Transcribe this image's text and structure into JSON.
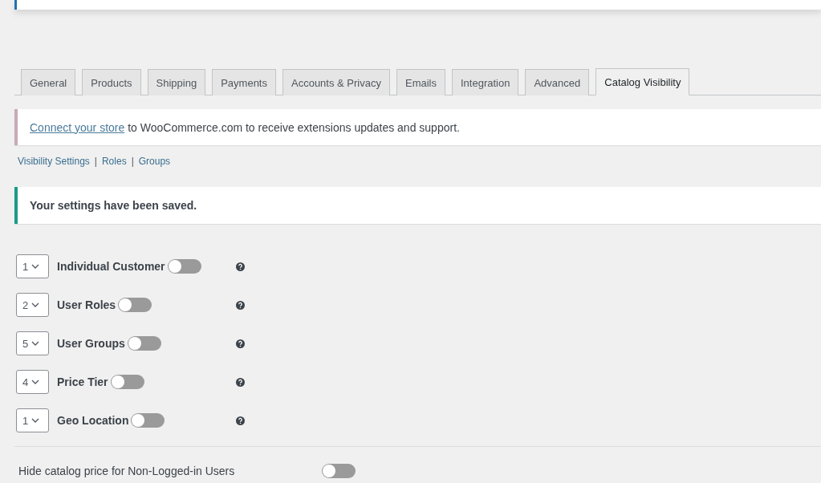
{
  "tabs": [
    {
      "label": "General",
      "selected": false
    },
    {
      "label": "Products",
      "selected": false
    },
    {
      "label": "Shipping",
      "selected": false
    },
    {
      "label": "Payments",
      "selected": false
    },
    {
      "label": "Accounts & Privacy",
      "selected": false
    },
    {
      "label": "Emails",
      "selected": false
    },
    {
      "label": "Integration",
      "selected": false
    },
    {
      "label": "Advanced",
      "selected": false
    },
    {
      "label": "Catalog Visibility",
      "selected": true
    }
  ],
  "connect_notice": {
    "link": "Connect your store",
    "text": "to WooCommerce.com to receive extensions updates and support."
  },
  "sub_links": [
    "Visibility Settings",
    "Roles",
    "Groups"
  ],
  "sub_separator": "|",
  "saved_notice": "Your settings have been saved.",
  "rules": [
    {
      "order": "1",
      "label": "Individual Customer",
      "on": false
    },
    {
      "order": "2",
      "label": "User Roles",
      "on": false
    },
    {
      "order": "5",
      "label": "User Groups",
      "on": false
    },
    {
      "order": "4",
      "label": "Price Tier",
      "on": false
    },
    {
      "order": "1",
      "label": "Geo Location",
      "on": false
    }
  ],
  "hide_price": {
    "label": "Hide catalog price for Non-Logged-in Users",
    "on": false
  }
}
